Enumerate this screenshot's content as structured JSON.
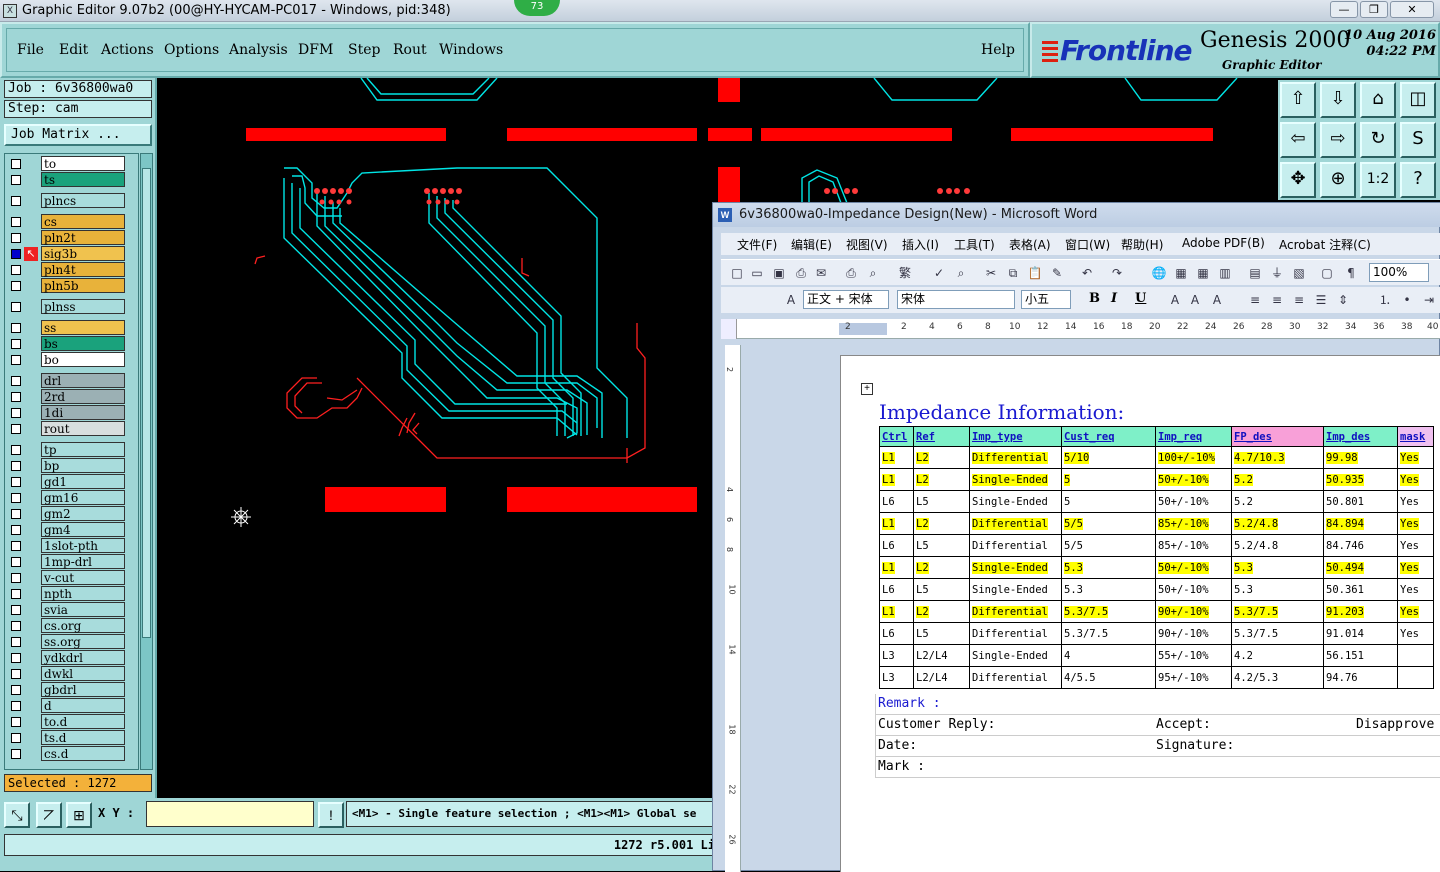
{
  "titlebar": {
    "icon": "X",
    "title": "Graphic Editor 9.07b2 (00@HY-HYCAM-PC017 - Windows, pid:348)",
    "badge": "73",
    "min": "—",
    "max": "❐",
    "close": "✕"
  },
  "menu": [
    "File",
    "Edit",
    "Actions",
    "Options",
    "Analysis",
    "DFM",
    "Step",
    "Rout",
    "Windows"
  ],
  "help": "Help",
  "brand": {
    "logo": "Frontline",
    "product": "Genesis 2000",
    "subtitle": "Graphic Editor",
    "date": "10 Aug 2016",
    "time": "04:22 PM"
  },
  "job": {
    "job_label": "Job  :  6v36800wa0",
    "step_label": "Step: cam",
    "matrix_button": "Job Matrix ..."
  },
  "layers": [
    {
      "name": "to",
      "color": "white",
      "gap": 0
    },
    {
      "name": "ts",
      "color": "green",
      "gap": 0
    },
    {
      "name": "plncs",
      "color": "teal",
      "gap": 5
    },
    {
      "name": "cs",
      "color": "orange",
      "gap": 5
    },
    {
      "name": "pln2t",
      "color": "orange",
      "gap": 0
    },
    {
      "name": "sig3b",
      "color": "gold",
      "gap": 0,
      "marked": true
    },
    {
      "name": "pln4t",
      "color": "orange",
      "gap": 0
    },
    {
      "name": "pln5b",
      "color": "orange",
      "gap": 0
    },
    {
      "name": "plnss",
      "color": "teal",
      "gap": 5
    },
    {
      "name": "ss",
      "color": "gold",
      "gap": 5
    },
    {
      "name": "bs",
      "color": "green",
      "gap": 0
    },
    {
      "name": "bo",
      "color": "white",
      "gap": 0
    },
    {
      "name": "drl",
      "color": "grey",
      "gap": 5
    },
    {
      "name": "2rd",
      "color": "grey",
      "gap": 0
    },
    {
      "name": "1di",
      "color": "grey",
      "gap": 0
    },
    {
      "name": "rout",
      "color": "lightgrey",
      "gap": 0
    },
    {
      "name": "tp",
      "color": "teal",
      "gap": 5
    },
    {
      "name": "bp",
      "color": "teal",
      "gap": 0
    },
    {
      "name": "gd1",
      "color": "teal",
      "gap": 0
    },
    {
      "name": "gm16",
      "color": "teal",
      "gap": 0
    },
    {
      "name": "gm2",
      "color": "teal",
      "gap": 0
    },
    {
      "name": "gm4",
      "color": "teal",
      "gap": 0
    },
    {
      "name": "1slot-pth",
      "color": "teal",
      "gap": 0
    },
    {
      "name": "1mp-drl",
      "color": "teal",
      "gap": 0
    },
    {
      "name": "v-cut",
      "color": "teal",
      "gap": 0
    },
    {
      "name": "npth",
      "color": "teal",
      "gap": 0
    },
    {
      "name": "svia",
      "color": "teal",
      "gap": 0
    },
    {
      "name": "cs.org",
      "color": "teal",
      "gap": 0
    },
    {
      "name": "ss.org",
      "color": "teal",
      "gap": 0
    },
    {
      "name": "ydkdrl",
      "color": "teal",
      "gap": 0
    },
    {
      "name": "dwkl",
      "color": "teal",
      "gap": 0
    },
    {
      "name": "gbdrl",
      "color": "teal",
      "gap": 0
    },
    {
      "name": "d",
      "color": "teal",
      "gap": 0
    },
    {
      "name": "to.d",
      "color": "teal",
      "gap": 0
    },
    {
      "name": "ts.d",
      "color": "teal",
      "gap": 0
    },
    {
      "name": "cs.d",
      "color": "teal",
      "gap": 0
    }
  ],
  "selected": "Selected : 1272",
  "status": {
    "xy_label": "X Y :",
    "xy_value": "",
    "hint": "<M1> - Single feature selection ; <M1><M1> Global se",
    "coord": "1272 r5.001 Li"
  },
  "word": {
    "title": "6v36800wa0-Impedance Design(New) - Microsoft Word",
    "icon": "W",
    "menu": [
      "文件(F)",
      "编辑(E)",
      "视图(V)",
      "插入(I)",
      "工具(T)",
      "表格(A)",
      "窗口(W)",
      "帮助(H)",
      "Adobe PDF(B)",
      "Acrobat 注释(C)"
    ],
    "zoom": "100%",
    "style": "正文 + 宋体",
    "font": "宋体",
    "size": "小五",
    "doc_title": "Impedance Information:",
    "columns": [
      "Ctrl",
      "Ref",
      "Imp_type",
      "Cust_req",
      "Imp_req",
      "FP_des",
      "Imp_des",
      "mask"
    ],
    "rows": [
      {
        "cells": [
          "L1",
          "L2",
          "Differential",
          "5/10",
          "100+/-10%",
          "4.7/10.3",
          "99.98",
          "Yes"
        ],
        "hl": true
      },
      {
        "cells": [
          "L1",
          "L2",
          "Single-Ended",
          "5",
          "50+/-10%",
          "5.2",
          "50.935",
          "Yes"
        ],
        "hl": true
      },
      {
        "cells": [
          "L6",
          "L5",
          "Single-Ended",
          "5",
          "50+/-10%",
          "5.2",
          "50.801",
          "Yes"
        ],
        "hl": false
      },
      {
        "cells": [
          "L1",
          "L2",
          "Differential",
          "5/5",
          "85+/-10%",
          "5.2/4.8",
          "84.894",
          "Yes"
        ],
        "hl": true
      },
      {
        "cells": [
          "L6",
          "L5",
          "Differential",
          "5/5",
          "85+/-10%",
          "5.2/4.8",
          "84.746",
          "Yes"
        ],
        "hl": false
      },
      {
        "cells": [
          "L1",
          "L2",
          "Single-Ended",
          "5.3",
          "50+/-10%",
          "5.3",
          "50.494",
          "Yes"
        ],
        "hl": true
      },
      {
        "cells": [
          "L6",
          "L5",
          "Single-Ended",
          "5.3",
          "50+/-10%",
          "5.3",
          "50.361",
          "Yes"
        ],
        "hl": false
      },
      {
        "cells": [
          "L1",
          "L2",
          "Differential",
          "5.3/7.5",
          "90+/-10%",
          "5.3/7.5",
          "91.203",
          "Yes"
        ],
        "hl": true
      },
      {
        "cells": [
          "L6",
          "L5",
          "Differential",
          "5.3/7.5",
          "90+/-10%",
          "5.3/7.5",
          "91.014",
          "Yes"
        ],
        "hl": false
      },
      {
        "cells": [
          "L3",
          "L2/L4",
          "Single-Ended",
          "4",
          "55+/-10%",
          "4.2",
          "56.151",
          ""
        ],
        "hl": false
      },
      {
        "cells": [
          "L3",
          "L2/L4",
          "Differential",
          "4/5.5",
          "95+/-10%",
          "4.2/5.3",
          "94.76",
          ""
        ],
        "hl": false
      }
    ],
    "remark": "Remark :",
    "customer_reply": "Customer Reply:",
    "accept": "Accept:",
    "disapprove": "Disapprove",
    "date": "Date:",
    "signature": "Signature:",
    "mark": "Mark :"
  },
  "colors": {
    "copper": "#ff0000",
    "trace": "#00e5e5",
    "panel": "#9fd6d6"
  }
}
